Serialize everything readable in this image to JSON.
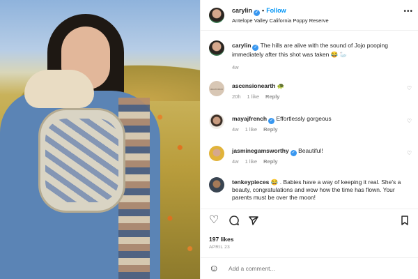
{
  "post": {
    "username": "carylin",
    "follow_label": "Follow",
    "dot": "•",
    "location": "Antelope Valley California Poppy Reserve",
    "more_label": "•••"
  },
  "caption": {
    "username": "carylin",
    "text": "The hills are alive with the sound of Jojo pooping immediately after this shot was taken 😂 🦢",
    "time": "4w"
  },
  "comments": [
    {
      "username": "ascensionearth",
      "text": "🐢",
      "time": "20h",
      "likes": "1 like",
      "reply": "Reply",
      "avatar_text": "ascension"
    },
    {
      "username": "mayajfrench",
      "verified": true,
      "text": "Effortlessly gorgeous",
      "time": "4w",
      "likes": "1 like",
      "reply": "Reply"
    },
    {
      "username": "jasminegamsworthy",
      "verified": true,
      "text": "Beautiful!",
      "time": "4w",
      "likes": "1 like",
      "reply": "Reply"
    },
    {
      "username": "tenkeypieces",
      "text": "😂 . Babies have a way of keeping it real. She's a beauty, congratulations and wow how the time has flown. Your parents must be over the moon!"
    }
  ],
  "stats": {
    "likes": "197 likes",
    "date": "APRIL 23"
  },
  "composer": {
    "placeholder": "Add a comment..."
  },
  "icons": {
    "heart": "heart-icon",
    "comment": "comment-icon",
    "share": "share-icon",
    "save": "bookmark-icon",
    "emoji": "emoji-icon"
  },
  "colors": {
    "accent": "#0095f6",
    "verified": "#3897f0",
    "muted": "#8e8e8e"
  }
}
